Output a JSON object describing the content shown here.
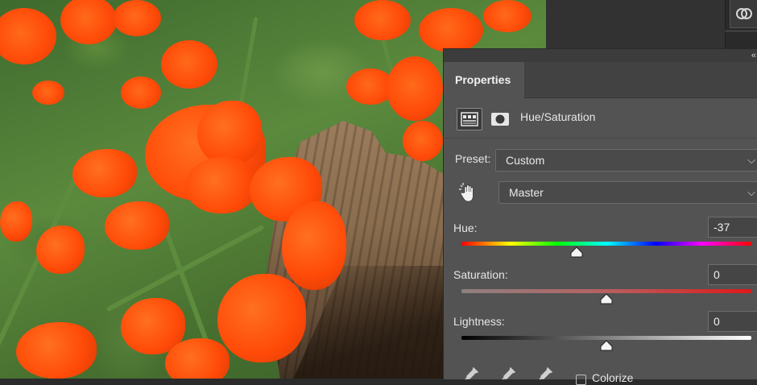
{
  "panel": {
    "tab_label": "Properties",
    "adjustment_title": "Hue/Saturation",
    "preset_label": "Preset:",
    "preset_value": "Custom",
    "channel_value": "Master",
    "hue": {
      "label": "Hue:",
      "value": "-37",
      "level_fraction": 0.397
    },
    "saturation": {
      "label": "Saturation:",
      "value": "0",
      "level_fraction": 0.5
    },
    "lightness": {
      "label": "Lightness:",
      "value": "0",
      "level_fraction": 0.5
    },
    "colorize_label": "Colorize"
  },
  "icons": {
    "collapse": "double-chevron-icon",
    "hand": "targeted-adjustment-hand-icon",
    "eyedropper": "eyedropper-icon"
  },
  "colors": {
    "panel_bg": "#535353",
    "flower": "#ff4c0a",
    "foliage": "#5b8a3d"
  }
}
